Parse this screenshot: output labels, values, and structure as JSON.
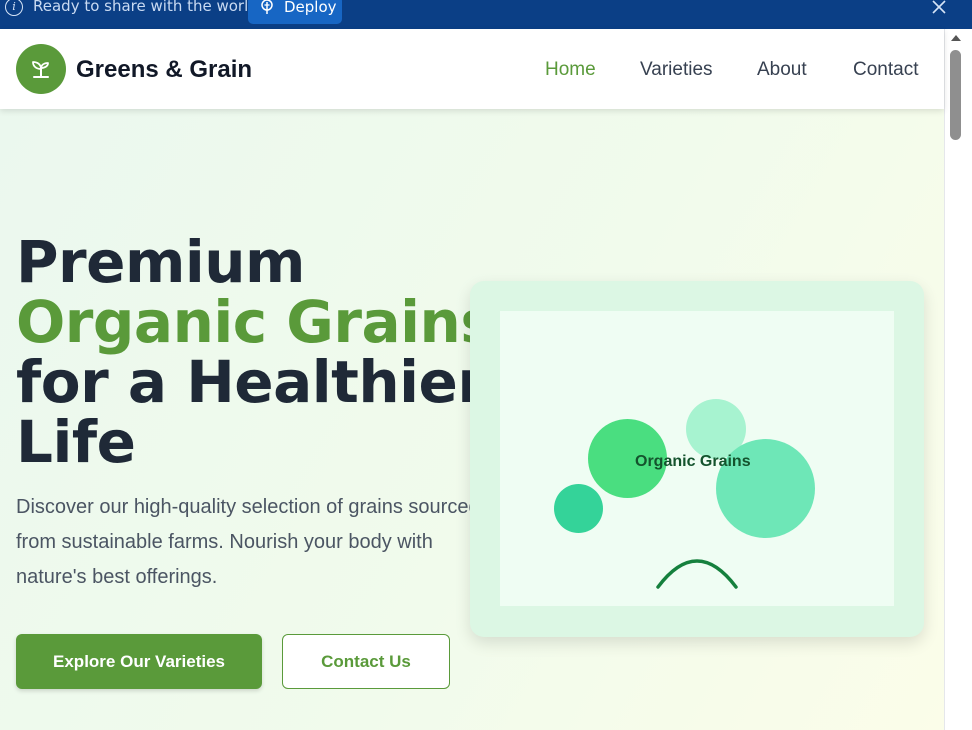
{
  "banner": {
    "message": "Ready to share with the world?",
    "deploy_label": "Deploy",
    "info_icon_glyph": "i"
  },
  "nav": {
    "brand": "Greens & Grain",
    "links": [
      {
        "label": "Home",
        "active": true
      },
      {
        "label": "Varieties",
        "active": false
      },
      {
        "label": "About",
        "active": false
      },
      {
        "label": "Contact",
        "active": false
      }
    ]
  },
  "hero": {
    "title_line1": "Premium",
    "title_accent": "Organic Grains",
    "title_line3": "for a Healthier",
    "title_line4": "Life",
    "description": "Discover our high-quality selection of grains sourced from sustainable farms. Nourish your body with nature's best offerings.",
    "primary_button": "Explore Our Varieties",
    "secondary_button": "Contact Us"
  },
  "illustration": {
    "label": "Organic Grains"
  },
  "colors": {
    "brand_green": "#5a9a3a",
    "banner_blue": "#0b3f86",
    "deploy_blue": "#1766c4",
    "heading_dark": "#1f2937"
  },
  "icons": {
    "banner_info": "info-icon",
    "deploy": "deploy-icon",
    "close": "close-icon",
    "logo": "sprout-icon"
  }
}
